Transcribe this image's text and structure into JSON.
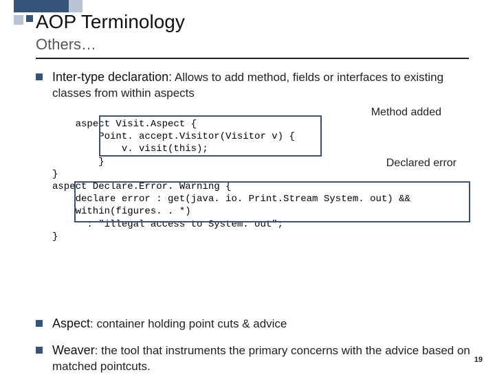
{
  "title": "AOP Terminology",
  "subtitle": "Others…",
  "bullets": {
    "b1": {
      "term": "Inter-type declaration:",
      "rest": " Allows to add method, fields or interfaces to existing classes from within aspects"
    },
    "b2": {
      "term": "Aspect",
      "rest": ": container holding point cuts & advice"
    },
    "b3": {
      "term": "Weaver",
      "rest": ": the tool that instruments the primary concerns with the advice based on matched pointcuts."
    }
  },
  "code": "aspect Visit.Aspect {\n        Point. accept.Visitor(Visitor v) {\n            v. visit(this);\n        }\n}\naspect Declare.Error. Warning {\n    declare error : get(java. io. Print.Stream System. out) &&\n    within(figures. . *)\n      : \"illegal access to System. out\";\n}",
  "annotations": {
    "a1": "Method added",
    "a2": "Declared error"
  },
  "page": "19"
}
